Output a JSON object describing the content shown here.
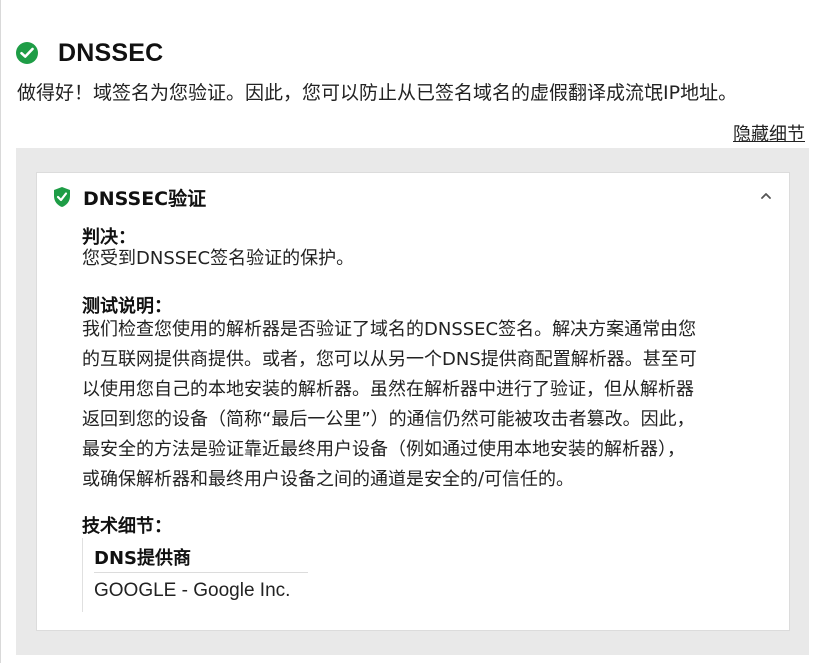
{
  "colors": {
    "success": "#1e9d46",
    "panel_bg": "#e9e9e9"
  },
  "header": {
    "icon": "check-circle-icon",
    "title": "DNSSEC"
  },
  "summary": "做得好！域签名为您验证。因此，您可以防止从已签名域名的虚假翻译成流氓IP地址。",
  "hide_details_label": "隐藏细节",
  "card": {
    "icon": "shield-check-icon",
    "title": "DNSSEC验证",
    "collapse_icon": "chevron-up-icon",
    "verdict_label": "判决：",
    "verdict_text": "您受到DNSSEC签名验证的保护。",
    "description_label": "测试说明：",
    "description_lines": [
      "我们检查您使用的解析器是否验证了域名的DNSSEC签名。解决方案通常由您",
      "的互联网提供商提供。或者，您可以从另一个DNS提供商配置解析器。甚至可",
      "以使用您自己的本地安装的解析器。虽然在解析器中进行了验证，但从解析器",
      "返回到您的设备（简称“最后一公里”）的通信仍然可能被攻击者篡改。因此，",
      "最安全的方法是验证靠近最终用户设备（例如通过使用本地安装的解析器），",
      "或确保解析器和最终用户设备之间的通道是安全的/可信任的。"
    ],
    "technical_label": "技术细节：",
    "technical": {
      "key": "DNS提供商",
      "value": "GOOGLE - Google Inc."
    }
  }
}
